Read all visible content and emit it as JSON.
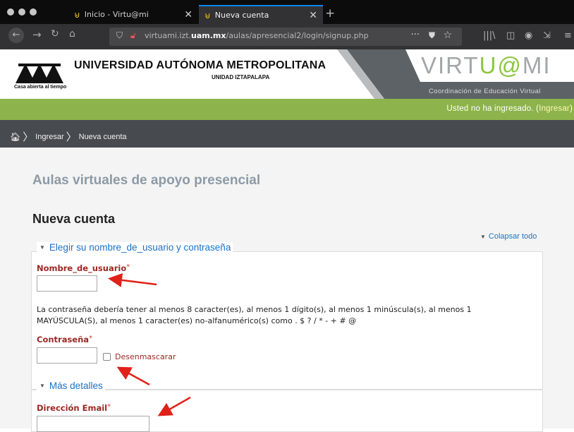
{
  "browser": {
    "tabs": [
      {
        "title": "Inicio - Virtu@mi",
        "active": false,
        "icon": "virtuami-favicon"
      },
      {
        "title": "Nueva cuenta",
        "active": true,
        "icon": "virtuami-favicon"
      }
    ],
    "url_prefix": "virtuami.izt.",
    "url_domain": "uam.mx",
    "url_path": "/aulas/apresencial2/login/signup.php",
    "page_actions": "···"
  },
  "header": {
    "university_name": "UNIVERSIDAD AUTÓNOMA METROPOLITANA",
    "unit_name": "UNIDAD IZTAPALAPA",
    "logo_caption": "Casa abierta al tiempo",
    "brand_left": "VIRT",
    "brand_highlight": "U@",
    "brand_right": "MI",
    "brand_subtitle": "Coordinación de Educación Virtual"
  },
  "login_bar": {
    "status_text": "Usted no ha ingresado. (",
    "login_link": "Ingresar",
    "close_paren": ")"
  },
  "breadcrumb": {
    "items": [
      "Ingresar",
      "Nueva cuenta"
    ]
  },
  "page": {
    "site_title": "Aulas virtuales de apoyo presencial",
    "heading": "Nueva cuenta",
    "collapse_all": "Colapsar todo"
  },
  "form": {
    "section1_title": "Elegir su nombre_de_usuario y contraseña",
    "username_label": "Nombre_de_usuario",
    "username_value": "",
    "password_policy": "La contraseña debería tener al menos 8 caracter(es), al menos 1 dígito(s), al menos 1 minúscula(s), al menos 1 MAYÚSCULA(S), al menos 1 caracter(es) no-alfanumérico(s) como . $ ? / * - + # @",
    "password_label": "Contraseña",
    "password_value": "",
    "unmask_label": "Desenmascarar",
    "section2_title": "Más detalles",
    "email_label": "Dirección Email",
    "email_value": "",
    "required_mark": "*"
  },
  "colors": {
    "green_bar": "#8db34c",
    "breadcrumb_bar": "#474b4f",
    "label_red": "#9d2723",
    "link_blue": "#1a73c7",
    "annotation_red": "#e0211a"
  }
}
